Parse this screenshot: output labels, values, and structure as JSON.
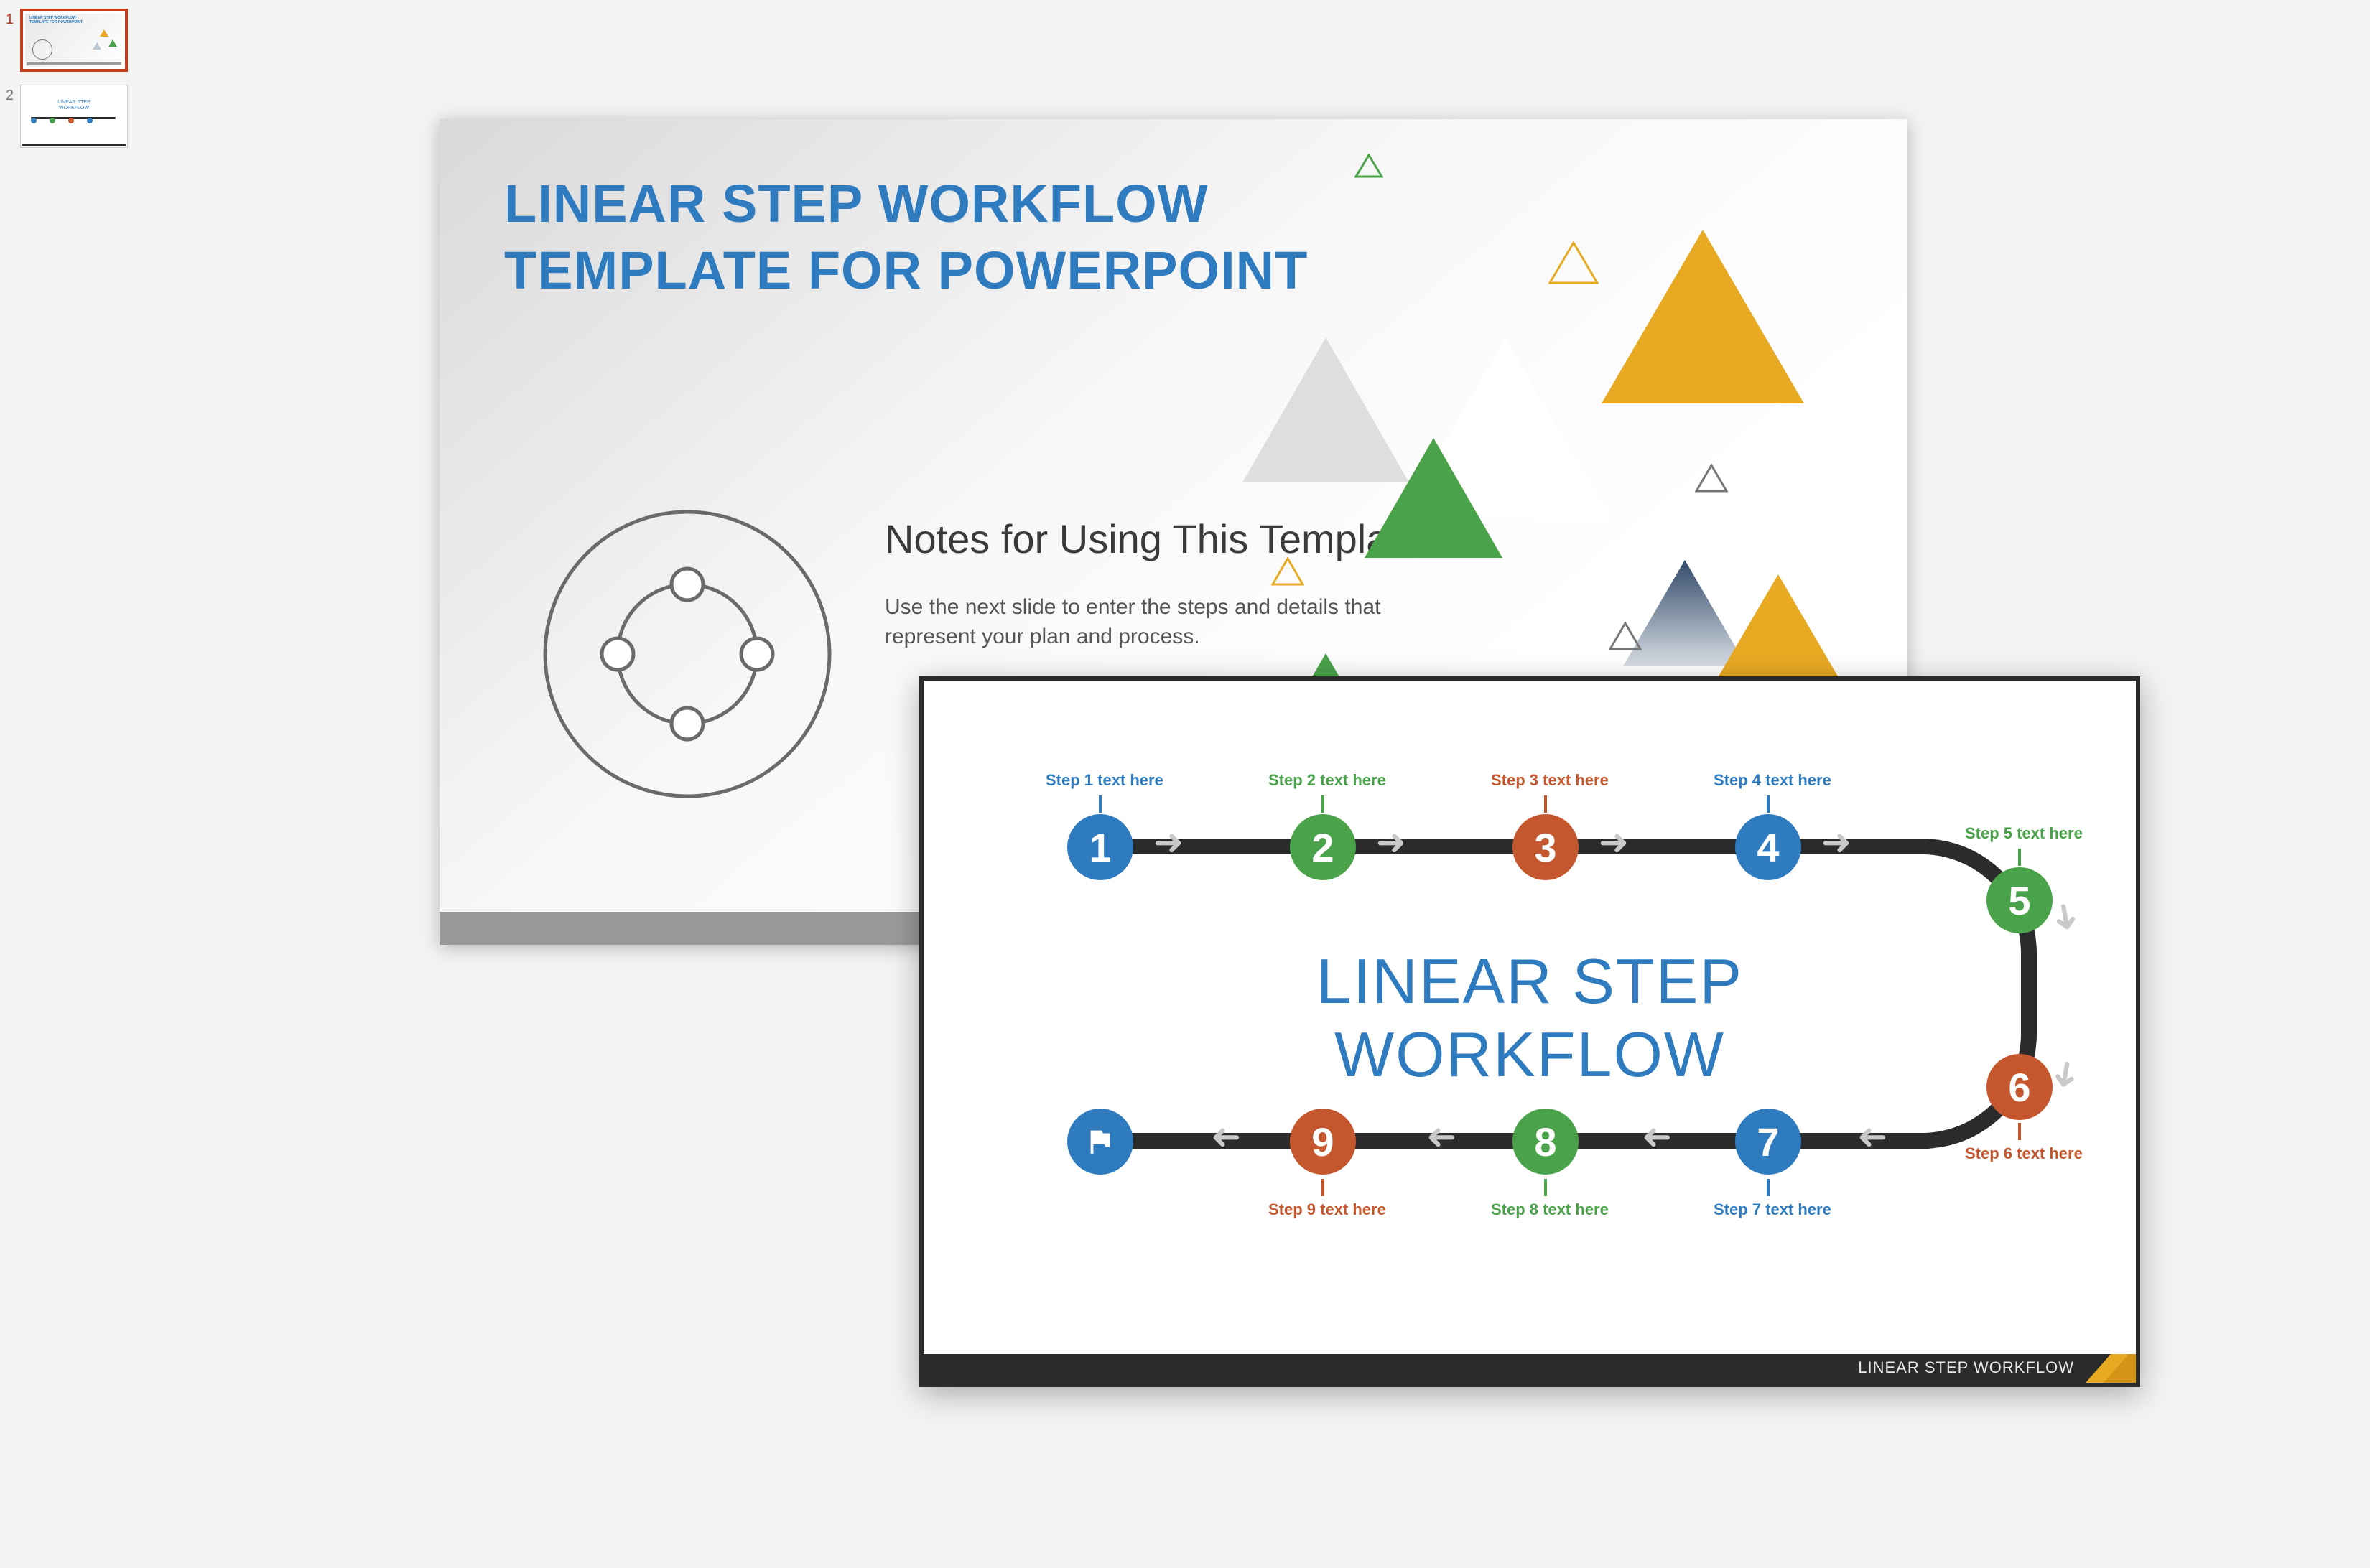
{
  "thumbnails": [
    {
      "number": "1",
      "active": true
    },
    {
      "number": "2",
      "active": false
    }
  ],
  "mainSlide": {
    "titleLine1": "LINEAR STEP WORKFLOW",
    "titleLine2": "TEMPLATE FOR POWERPOINT",
    "notesHeading": "Notes for Using This Template",
    "notesBody": "Use the next slide to enter the steps and details that represent your plan and process."
  },
  "overlay": {
    "centerTitleLine1": "LINEAR STEP",
    "centerTitleLine2": "WORKFLOW",
    "footerText": "LINEAR STEP WORKFLOW",
    "steps": [
      {
        "num": "1",
        "label": "Step 1 text here",
        "labelColor": "lbl-blue",
        "nodeColor": "c-blue"
      },
      {
        "num": "2",
        "label": "Step 2 text here",
        "labelColor": "lbl-green",
        "nodeColor": "c-green"
      },
      {
        "num": "3",
        "label": "Step 3 text here",
        "labelColor": "lbl-orange",
        "nodeColor": "c-orange"
      },
      {
        "num": "4",
        "label": "Step 4 text here",
        "labelColor": "lbl-blue",
        "nodeColor": "c-blue"
      },
      {
        "num": "5",
        "label": "Step 5 text here",
        "labelColor": "lbl-green",
        "nodeColor": "c-green"
      },
      {
        "num": "6",
        "label": "Step 6 text here",
        "labelColor": "lbl-orange",
        "nodeColor": "c-orange"
      },
      {
        "num": "7",
        "label": "Step 7 text here",
        "labelColor": "lbl-blue",
        "nodeColor": "c-blue"
      },
      {
        "num": "8",
        "label": "Step 8 text here",
        "labelColor": "lbl-green",
        "nodeColor": "c-green"
      },
      {
        "num": "9",
        "label": "Step 9 text here",
        "labelColor": "lbl-orange",
        "nodeColor": "c-orange"
      }
    ]
  },
  "thumb2CenterLine1": "LINEAR STEP",
  "thumb2CenterLine2": "WORKFLOW"
}
